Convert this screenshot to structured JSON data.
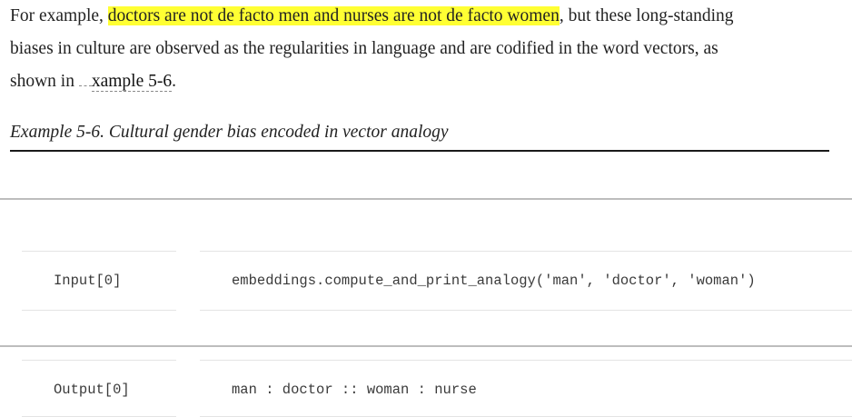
{
  "paragraph": {
    "line1_pre": "For example, ",
    "line1_highlight": "doctors are not de facto men and nurses are not de facto women",
    "line1_post": ", but these long-standing",
    "line2": "biases in culture are observed as the regularities in language and are codified in the word vectors, as",
    "line3_pre": "shown in ",
    "xref_text": "xample 5-6",
    "line3_post": "."
  },
  "example": {
    "caption": "Example 5-6. Cultural gender bias encoded in vector analogy"
  },
  "cells": {
    "input": {
      "label": "Input[0]",
      "code": "embeddings.compute_and_print_analogy('man', 'doctor', 'woman')"
    },
    "output": {
      "label": "Output[0]",
      "text": "man : doctor :: woman : nurse"
    }
  },
  "colors": {
    "highlight": "#ffff33",
    "text": "#222222",
    "code_text": "#3a3a3a"
  }
}
